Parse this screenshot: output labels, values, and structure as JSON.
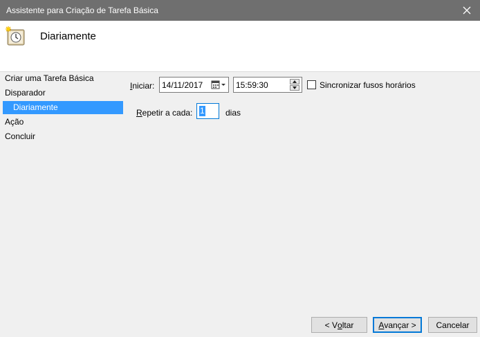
{
  "window": {
    "title": "Assistente para Criação de Tarefa Básica"
  },
  "header": {
    "title": "Diariamente",
    "icon": "scheduled-task-clock-icon"
  },
  "sidebar": {
    "items": [
      {
        "label": "Criar uma Tarefa Básica",
        "active": false
      },
      {
        "label": "Disparador",
        "active": false
      },
      {
        "label": "Diariamente",
        "active": true
      },
      {
        "label": "Ação",
        "active": false
      },
      {
        "label": "Concluir",
        "active": false
      }
    ]
  },
  "form": {
    "start_label": "Iniciar:",
    "start_date": "14/11/2017",
    "start_time": "15:59:30",
    "sync_label": "Sincronizar fusos horários",
    "sync_checked": false,
    "repeat_label": "Repetir a cada:",
    "repeat_value": "1",
    "repeat_unit": "dias"
  },
  "buttons": {
    "back": "< Voltar",
    "next": "Avançar >",
    "cancel": "Cancelar"
  },
  "colors": {
    "titlebar": "#6f6f6f",
    "selection": "#3399ff",
    "focus_border": "#0078d7"
  }
}
